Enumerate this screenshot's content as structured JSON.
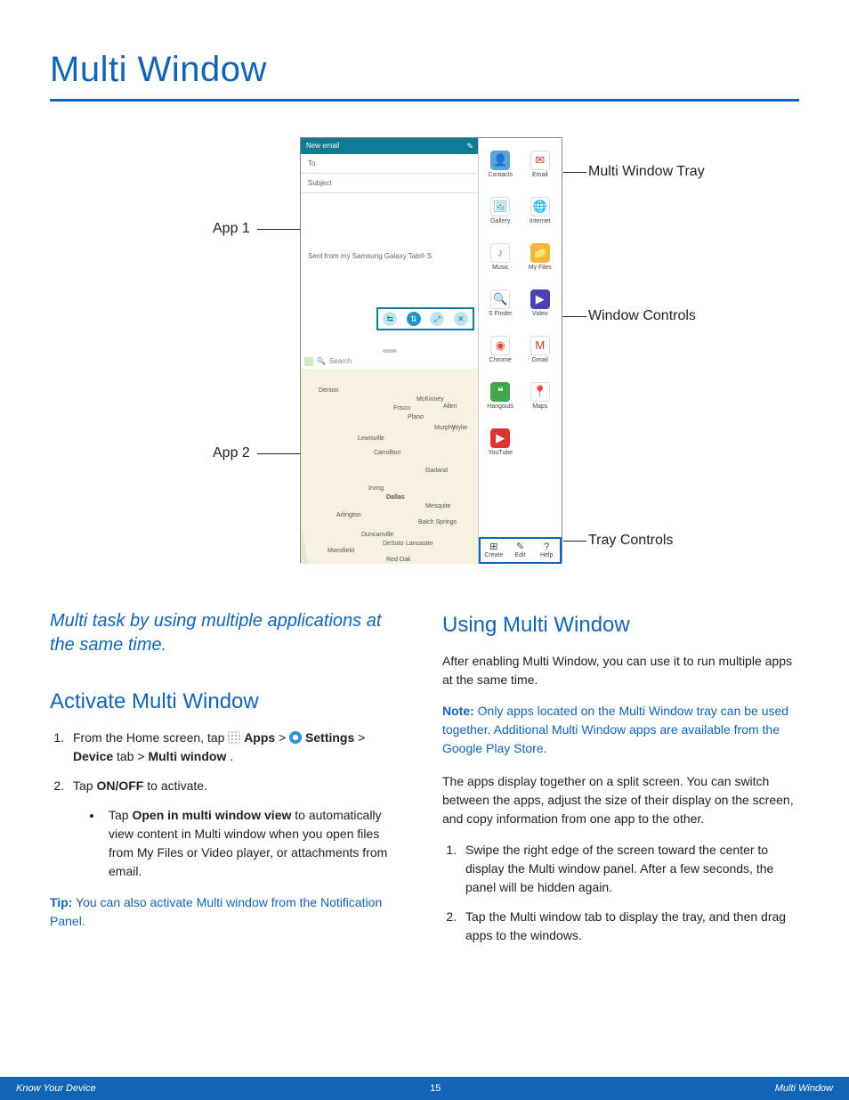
{
  "title": "Multi Window",
  "figure": {
    "labels": {
      "app1": "App 1",
      "app2": "App 2",
      "tray": "Multi Window Tray",
      "controls": "Window Controls",
      "tray_controls": "Tray Controls"
    },
    "app1": {
      "header": "New email",
      "to": "To",
      "subject": "Subject",
      "signature": "Sent from my Samsung Galaxy Tab® S"
    },
    "app2": {
      "search_placeholder": "Search",
      "cities": [
        "Denton",
        "Plano",
        "Dallas",
        "Garland",
        "Mesquite",
        "Arlington",
        "Irving",
        "Carrollton",
        "Lewisville",
        "McKinney",
        "Mansfield",
        "Red Oak",
        "DeSoto",
        "Lancaster",
        "Duncanville",
        "Balch Springs",
        "Murphy",
        "Wylie",
        "Frisco",
        "Allen"
      ]
    },
    "tray_apps": [
      {
        "label": "Contacts",
        "color": "#59a3d6",
        "glyph": "👤"
      },
      {
        "label": "Email",
        "color": "#ffffff",
        "glyph": "✉",
        "fg": "#d33"
      },
      {
        "label": "Gallery",
        "color": "#ffffff",
        "glyph": "🖼",
        "fg": "#29a3c2"
      },
      {
        "label": "Internet",
        "color": "#ffffff",
        "glyph": "🌐",
        "fg": "#3a8bd8"
      },
      {
        "label": "Music",
        "color": "#ffffff",
        "glyph": "♪",
        "fg": "#29c2c2"
      },
      {
        "label": "My Files",
        "color": "#f5b63a",
        "glyph": "📁"
      },
      {
        "label": "S Finder",
        "color": "#ffffff",
        "glyph": "🔍",
        "fg": "#3a8bd8"
      },
      {
        "label": "Video",
        "color": "#4a3fb5",
        "glyph": "▶"
      },
      {
        "label": "Chrome",
        "color": "#ffffff",
        "glyph": "◉",
        "fg": "#d94c3d"
      },
      {
        "label": "Gmail",
        "color": "#ffffff",
        "glyph": "M",
        "fg": "#d33"
      },
      {
        "label": "Hangouts",
        "color": "#3fa64b",
        "glyph": "❝"
      },
      {
        "label": "Maps",
        "color": "#ffffff",
        "glyph": "📍",
        "fg": "#3fa64b"
      },
      {
        "label": "YouTube",
        "color": "#d33",
        "glyph": "▶"
      }
    ],
    "tray_controls": [
      {
        "label": "Create",
        "glyph": "⊞"
      },
      {
        "label": "Edit",
        "glyph": "✎"
      },
      {
        "label": "Help",
        "glyph": "?"
      }
    ]
  },
  "left": {
    "tagline": "Multi task by using multiple applications at the same time.",
    "h2": "Activate Multi Window",
    "step1_a": "From the Home screen, tap ",
    "step1_apps": "Apps",
    "step1_gt1": " > ",
    "step1_settings": "Settings",
    "step1_gt2": " > ",
    "step1_device": "Device",
    "step1_tab": " tab > ",
    "step1_mw": "Multi window",
    "step1_period": ".",
    "step2_a": "Tap ",
    "step2_onoff": "ON/OFF",
    "step2_b": " to activate.",
    "bullet_a": "Tap ",
    "bullet_bold": "Open in multi window view",
    "bullet_b": " to automatically view content in Multi window when you open files from My Files or Video player, or attachments from email.",
    "tip_label": "Tip:",
    "tip_text": " You can also activate Multi window from the Notification Panel."
  },
  "right": {
    "h2": "Using Multi Window",
    "p1": "After enabling Multi Window, you can use it to run multiple apps at the same time.",
    "note_label": "Note:",
    "note_text": " Only apps located on the Multi Window tray can be used together. Additional Multi Window apps are available from the Google Play Store.",
    "p2": "The apps display together on a split screen. You can switch between the apps, adjust the size of their display on the screen, and copy information from one app to the other.",
    "step1": "Swipe the right edge of the screen toward the center to display the Multi window panel. After a few seconds, the panel will be hidden again.",
    "step2": "Tap the Multi window tab to display the tray, and then drag apps to the windows."
  },
  "footer": {
    "left": "Know Your Device",
    "page": "15",
    "right": "Multi Window"
  }
}
